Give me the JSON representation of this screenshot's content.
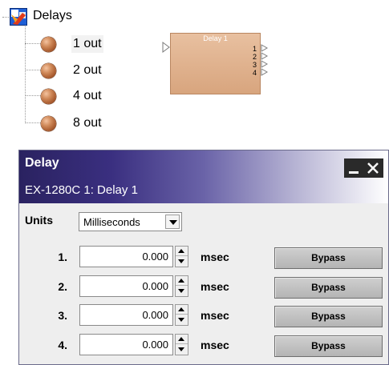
{
  "tree": {
    "root_label": "Delays",
    "root_icon": "delays-module-icon",
    "items": [
      {
        "label": "1 out",
        "icon": "component-ball-icon"
      },
      {
        "label": "2 out",
        "icon": "component-ball-icon"
      },
      {
        "label": "4 out",
        "icon": "component-ball-icon"
      },
      {
        "label": "8 out",
        "icon": "component-ball-icon"
      }
    ]
  },
  "block": {
    "title": "Delay 1",
    "outputs": [
      "1",
      "2",
      "3",
      "4"
    ]
  },
  "dialog": {
    "title": "Delay",
    "subtitle": "EX-1280C 1: Delay 1",
    "units_label": "Units",
    "units_value": "Milliseconds",
    "rows": [
      {
        "number": "1.",
        "value": "0.000",
        "unit": "msec",
        "bypass_label": "Bypass"
      },
      {
        "number": "2.",
        "value": "0.000",
        "unit": "msec",
        "bypass_label": "Bypass"
      },
      {
        "number": "3.",
        "value": "0.000",
        "unit": "msec",
        "bypass_label": "Bypass"
      },
      {
        "number": "4.",
        "value": "0.000",
        "unit": "msec",
        "bypass_label": "Bypass"
      }
    ]
  },
  "colors": {
    "titlebar_dark": "#2a2260",
    "block_fill": "#d8a57e",
    "bypass_fill": "#bdbdbd"
  }
}
